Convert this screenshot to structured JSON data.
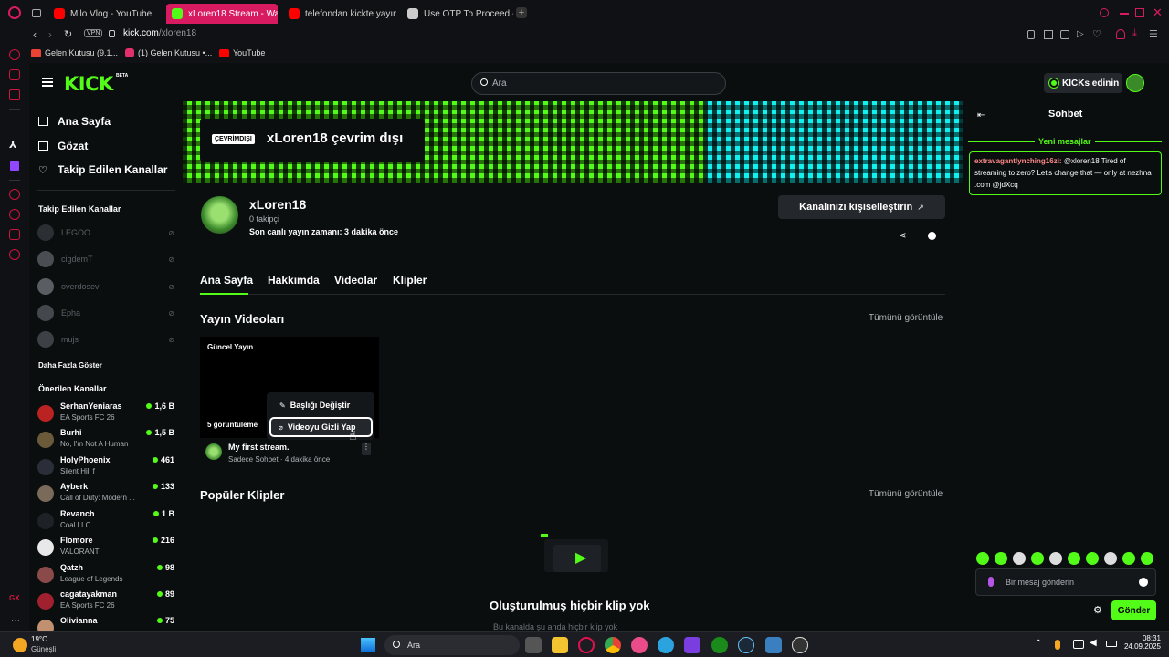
{
  "browser": {
    "tabs": [
      {
        "title": "Milo Vlog - YouTube",
        "active": false,
        "favicon_color": "#ff0000"
      },
      {
        "title": "xLoren18 Stream - Watch",
        "active": true,
        "favicon_color": "#53fc18"
      },
      {
        "title": "telefondan kickte yayın y",
        "active": false,
        "favicon_color": "#ff0000"
      },
      {
        "title": "Use OTP To Proceed - bit",
        "active": false,
        "favicon_color": "#cccccc"
      }
    ],
    "vpn_label": "VPN",
    "url_host": "kick.com",
    "url_path": "/xloren18",
    "bookmarks": [
      {
        "label": "Gelen Kutusu (9.1...",
        "color": "#ea4335"
      },
      {
        "label": "(1) Gelen Kutusu •...",
        "color": "#e1306c"
      },
      {
        "label": "YouTube",
        "color": "#ff0000"
      }
    ]
  },
  "kick": {
    "logo": "KICK",
    "logo_badge": "BETA",
    "search_placeholder": "Ara",
    "kicks_button": "KICKs edinin",
    "sidebar": {
      "nav": [
        {
          "label": "Ana Sayfa",
          "icon": "home-icon"
        },
        {
          "label": "Gözat",
          "icon": "browse-icon"
        },
        {
          "label": "Takip Edilen Kanallar",
          "icon": "heart-icon"
        }
      ],
      "following_title": "Takip Edilen Kanallar",
      "following": [
        {
          "name": "LEGOO"
        },
        {
          "name": "cigdemT"
        },
        {
          "name": "overdosevl"
        },
        {
          "name": "Epha"
        },
        {
          "name": "mujs"
        }
      ],
      "show_more": "Daha Fazla Göster",
      "recommended_title": "Önerilen Kanallar",
      "recommended": [
        {
          "name": "SerhanYeniaras",
          "game": "EA Sports FC 26",
          "viewers": "1,6 B"
        },
        {
          "name": "Burhi",
          "game": "No, I'm Not A Human",
          "viewers": "1,5 B"
        },
        {
          "name": "HolyPhoenix",
          "game": "Silent Hill f",
          "viewers": "461"
        },
        {
          "name": "Ayberk",
          "game": "Call of Duty: Modern ...",
          "viewers": "133"
        },
        {
          "name": "Revanch",
          "game": "Coal LLC",
          "viewers": "1 B"
        },
        {
          "name": "Flomore",
          "game": "VALORANT",
          "viewers": "216"
        },
        {
          "name": "Qatzh",
          "game": "League of Legends",
          "viewers": "98"
        },
        {
          "name": "cagatayakman",
          "game": "EA Sports FC 26",
          "viewers": "89"
        },
        {
          "name": "Olivianna",
          "game": "",
          "viewers": "75"
        }
      ]
    },
    "banner": {
      "offline_badge": "ÇEVRİMDIŞI",
      "offline_text": "xLoren18 çevrim dışı"
    },
    "channel": {
      "name": "xLoren18",
      "followers": "0 takipçi",
      "last_live": "Son canlı yayın zamanı: 3 dakika önce",
      "customize_button": "Kanalınızı kişiselleştirin"
    },
    "tabs": [
      "Ana Sayfa",
      "Hakkımda",
      "Videolar",
      "Klipler"
    ],
    "videos_section": {
      "title": "Yayın Videoları",
      "view_all": "Tümünü görüntüle",
      "card": {
        "label": "Güncel Yayın",
        "views": "5 görüntüleme",
        "title": "My first stream.",
        "meta": "Sadece Sohbet · 4 dakika önce"
      },
      "context_menu": [
        {
          "label": "Başlığı Değiştir",
          "icon": "pencil-icon"
        },
        {
          "label": "Videoyu Gizli Yap",
          "icon": "eye-slash-icon"
        }
      ]
    },
    "clips_section": {
      "title": "Popüler Klipler",
      "view_all": "Tümünü görüntüle",
      "empty_title": "Oluşturulmuş hiçbir klip yok",
      "empty_sub": "Bu kanalda şu anda hiçbir klip yok"
    },
    "chat": {
      "title": "Sohbet",
      "new_messages": "Yeni mesajlar",
      "message_user": "extravagantlynching16zi:",
      "message_text": "@xloren18 Tired of streaming to zero? Let's change that — only at nezhna .com @jdXcq",
      "input_placeholder": "Bir mesaj gönderin",
      "send_button": "Gönder"
    }
  },
  "taskbar": {
    "weather_temp": "19°C",
    "weather_text": "Güneşli",
    "search": "Ara",
    "time": "08:31",
    "date": "24.09.2025"
  },
  "colors": {
    "accent": "#53fc18",
    "background": "#0b0e0f",
    "opera_red": "#c8163f"
  }
}
